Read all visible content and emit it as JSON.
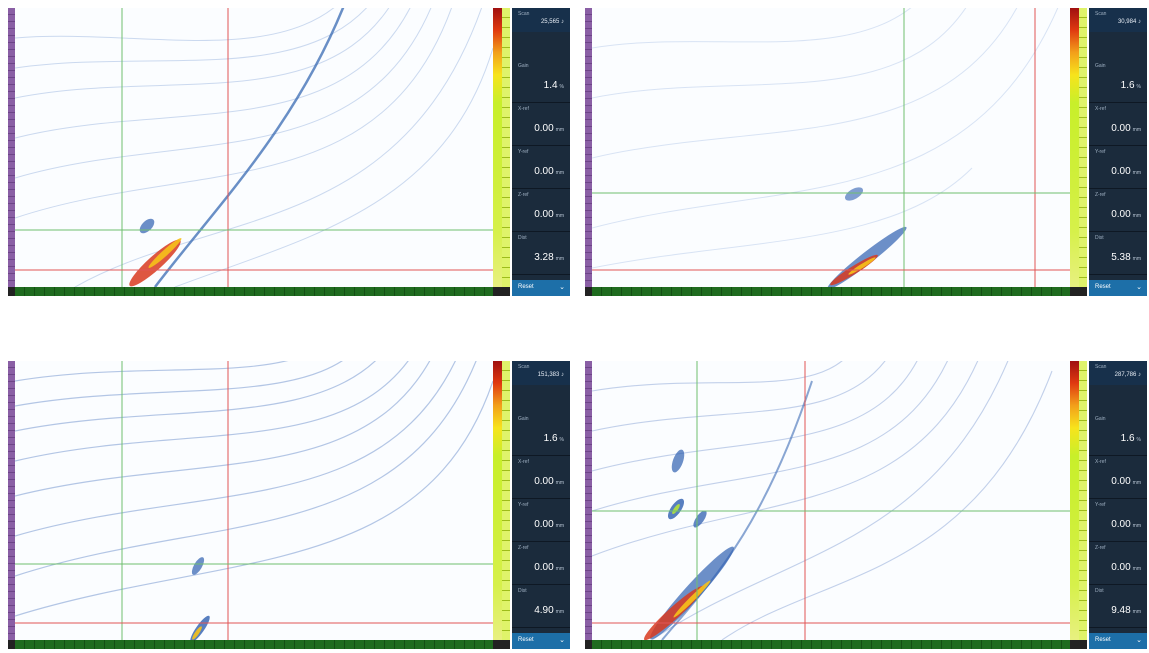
{
  "panels": [
    {
      "top_label": "Scan",
      "top_value": "25,565 ♪",
      "fields": [
        {
          "label": "Gain",
          "value": "1.4",
          "unit": "%"
        },
        {
          "label": "X-ref",
          "value": "0.00",
          "unit": "mm"
        },
        {
          "label": "Y-ref",
          "value": "0.00",
          "unit": "mm"
        },
        {
          "label": "Z-ref",
          "value": "0.00",
          "unit": "mm"
        },
        {
          "label": "Dist",
          "value": "3.28",
          "unit": "mm"
        }
      ],
      "reset_label": "Reset"
    },
    {
      "top_label": "Scan",
      "top_value": "30,984 ♪",
      "fields": [
        {
          "label": "Gain",
          "value": "1.6",
          "unit": "%"
        },
        {
          "label": "X-ref",
          "value": "0.00",
          "unit": "mm"
        },
        {
          "label": "Y-ref",
          "value": "0.00",
          "unit": "mm"
        },
        {
          "label": "Z-ref",
          "value": "0.00",
          "unit": "mm"
        },
        {
          "label": "Dist",
          "value": "5.38",
          "unit": "mm"
        }
      ],
      "reset_label": "Reset"
    },
    {
      "top_label": "Scan",
      "top_value": "151,383 ♪",
      "fields": [
        {
          "label": "Gain",
          "value": "1.6",
          "unit": "%"
        },
        {
          "label": "X-ref",
          "value": "0.00",
          "unit": "mm"
        },
        {
          "label": "Y-ref",
          "value": "0.00",
          "unit": "mm"
        },
        {
          "label": "Z-ref",
          "value": "0.00",
          "unit": "mm"
        },
        {
          "label": "Dist",
          "value": "4.90",
          "unit": "mm"
        }
      ],
      "reset_label": "Reset"
    },
    {
      "top_label": "Scan",
      "top_value": "287,786 ♪",
      "fields": [
        {
          "label": "Gain",
          "value": "1.6",
          "unit": "%"
        },
        {
          "label": "X-ref",
          "value": "0.00",
          "unit": "mm"
        },
        {
          "label": "Y-ref",
          "value": "0.00",
          "unit": "mm"
        },
        {
          "label": "Z-ref",
          "value": "0.00",
          "unit": "mm"
        },
        {
          "label": "Dist",
          "value": "9.48",
          "unit": "mm"
        }
      ],
      "reset_label": "Reset"
    }
  ],
  "colors": {
    "cursor_green": "#6fbf6f",
    "cursor_red": "#e05555",
    "panel_bg": "#1b2b3c",
    "reset_blue": "#1d6fa8"
  },
  "icons": {
    "reset_chevron": "chevron-down-icon"
  }
}
